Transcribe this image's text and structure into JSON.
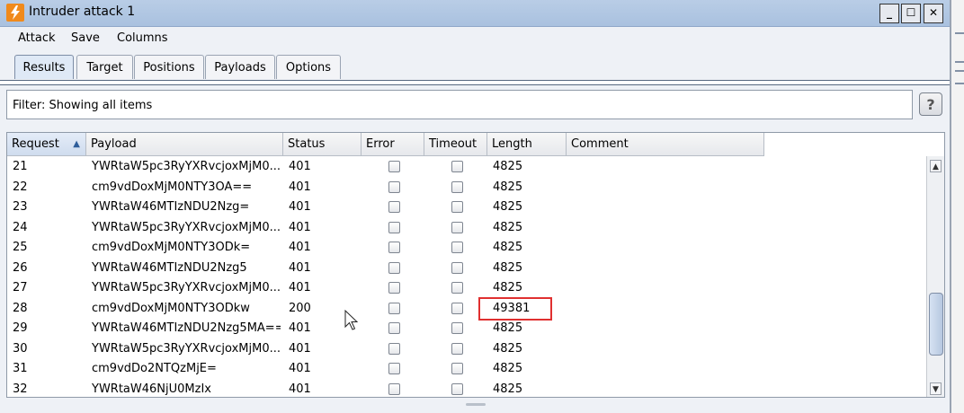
{
  "window": {
    "title": "Intruder attack 1",
    "minimize": "_",
    "maximize": "☐",
    "close": "✕"
  },
  "menu": [
    "Attack",
    "Save",
    "Columns"
  ],
  "tabs": [
    {
      "label": "Results",
      "active": true
    },
    {
      "label": "Target"
    },
    {
      "label": "Positions"
    },
    {
      "label": "Payloads"
    },
    {
      "label": "Options"
    }
  ],
  "filter": {
    "text": "Filter:  Showing all items",
    "help": "?"
  },
  "table": {
    "columns": [
      "Request",
      "Payload",
      "Status",
      "Error",
      "Timeout",
      "Length",
      "Comment"
    ],
    "sorted_column": "Request",
    "rows": [
      {
        "request": "21",
        "payload": "YWRtaW5pc3RyYXRvcjoxMjM0...",
        "status": "401",
        "length": "4825"
      },
      {
        "request": "22",
        "payload": "cm9vdDoxMjM0NTY3OA==",
        "status": "401",
        "length": "4825"
      },
      {
        "request": "23",
        "payload": "YWRtaW46MTIzNDU2Nzg=",
        "status": "401",
        "length": "4825"
      },
      {
        "request": "24",
        "payload": "YWRtaW5pc3RyYXRvcjoxMjM0...",
        "status": "401",
        "length": "4825"
      },
      {
        "request": "25",
        "payload": "cm9vdDoxMjM0NTY3ODk=",
        "status": "401",
        "length": "4825"
      },
      {
        "request": "26",
        "payload": "YWRtaW46MTIzNDU2Nzg5",
        "status": "401",
        "length": "4825"
      },
      {
        "request": "27",
        "payload": "YWRtaW5pc3RyYXRvcjoxMjM0...",
        "status": "401",
        "length": "4825"
      },
      {
        "request": "28",
        "payload": "cm9vdDoxMjM0NTY3ODkw",
        "status": "200",
        "length": "49381"
      },
      {
        "request": "29",
        "payload": "YWRtaW46MTIzNDU2Nzg5MA==",
        "status": "401",
        "length": "4825"
      },
      {
        "request": "30",
        "payload": "YWRtaW5pc3RyYXRvcjoxMjM0...",
        "status": "401",
        "length": "4825"
      },
      {
        "request": "31",
        "payload": "cm9vdDo2NTQzMjE=",
        "status": "401",
        "length": "4825"
      },
      {
        "request": "32",
        "payload": "YWRtaW46NjU0MzIx",
        "status": "401",
        "length": "4825"
      }
    ]
  },
  "colors": {
    "titlebar": "#b0c6e2",
    "highlight": "#e03030",
    "tab_line": "#56687f"
  },
  "icons": {
    "app": "burp-lightning-icon",
    "sort": "sort-ascending-icon",
    "cursor": "mouse-pointer-icon"
  }
}
